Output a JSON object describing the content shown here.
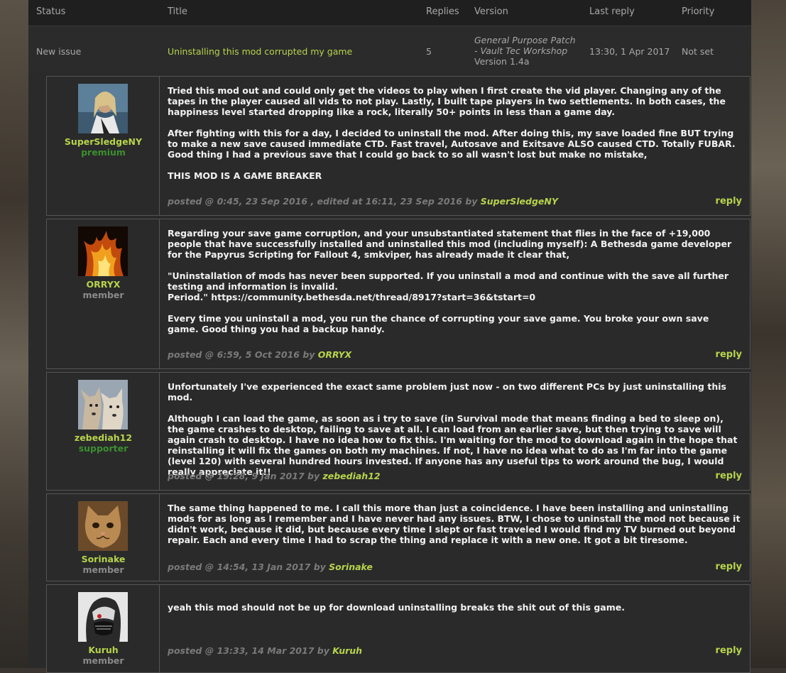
{
  "issue_table": {
    "headers": [
      "Status",
      "Title",
      "Replies",
      "Version",
      "Last reply",
      "Priority"
    ],
    "row": {
      "status": "New issue",
      "title": "Uninstalling this mod corrupted my game",
      "replies": "5",
      "version_line1": "General Purpose Patch",
      "version_line2": "- Vault Tec Workshop",
      "version_line3": "Version 1.4a",
      "last_reply": "13:30, 1 Apr 2017",
      "priority": "Not set"
    }
  },
  "reply_label": "reply",
  "posts": [
    {
      "username": "SuperSledgeNY",
      "role": "premium",
      "paragraphs": [
        "Tried this mod out and could only get the videos to play when I first create the vid player. Changing any of the tapes in the player caused all vids to not play. Lastly, I built tape players in two settlements. In both cases, the happiness level started dropping like a rock, literally 50+ points in less than a game day.",
        "After fighting with this for a day, I decided to uninstall the mod. After doing this, my save loaded fine BUT trying to make a new save caused immediate CTD. Fast travel, Autosave and Exitsave ALSO caused CTD. Totally FUBAR. Good thing I had a previous save that I could go back to so all wasn't lost but make no mistake,",
        "THIS MOD IS A GAME BREAKER"
      ],
      "meta": "posted @ 0:45, 23 Sep 2016 , edited at 16:11, 23 Sep 2016 by",
      "meta_user": "SuperSledgeNY",
      "avatar": "woman-portrait-avatar"
    },
    {
      "username": "ORRYX",
      "role": "member",
      "paragraphs": [
        "Regarding your save game corruption, and your unsubstantiated statement that flies in the face of +19,000 people that have successfully installed and uninstalled this mod (including myself): A Bethesda game developer for the Papyrus Scripting for Fallout 4, smkviper, has already made it clear that,",
        "\"Uninstallation of mods has never been supported. If you uninstall a mod and continue with the save all further testing and information is invalid.\nPeriod.\" https://community.bethesda.net/thread/8917?start=36&tstart=0",
        "Every time you uninstall a mod, you run the chance of corrupting your save game. You broke your own save game. Good thing you had a backup handy."
      ],
      "meta": "posted @ 6:59, 5 Oct 2016 by",
      "meta_user": "ORRYX",
      "avatar": "fire-figure-avatar"
    },
    {
      "username": "zebediah12",
      "role": "supporter",
      "paragraphs": [
        "Unfortunately I've experienced the exact same problem just now - on two different PCs by just uninstalling this mod.",
        "Although I can load the game, as soon as i try to save (in Survival mode that means finding a bed to sleep on), the game crashes to desktop, failing to save at all. I can load from an earlier save, but then trying to save will again crash to desktop. I have no idea how to fix this. I'm waiting for the mod to download again in the hope that reinstalling it will fix the games on both my machines. If not, I have no idea what to do as I'm far into the game (level 120) with several hundred hours invested. If anyone has any useful tips to work around the bug, I would really appreciate it!!"
      ],
      "meta": "posted @ 19:28, 9 Jan 2017 by",
      "meta_user": "zebediah12",
      "avatar": "two-dogs-avatar"
    },
    {
      "username": "Sorinake",
      "role": "member",
      "paragraphs": [
        "The same thing happened to me. I call this more than just a coincidence. I have been installing and uninstalling mods for as long as I remember and I have never had any issues. BTW, I chose to uninstall the mod not because it didn't work, because it did, but because every time I slept or fast traveled I would find my TV burned out beyond repair. Each and every time I had to scrap the thing and replace it with a new one. It got a bit tiresome."
      ],
      "meta": "posted @ 14:54, 13 Jan 2017 by",
      "meta_user": "Sorinake",
      "avatar": "kitten-avatar"
    },
    {
      "username": "Kuruh",
      "role": "member",
      "paragraphs": [
        "yeah this mod should not be up for download uninstalling breaks the shit out of this game."
      ],
      "meta": "posted @ 13:33, 14 Mar 2017 by",
      "meta_user": "Kuruh",
      "avatar": "masked-character-avatar"
    }
  ]
}
